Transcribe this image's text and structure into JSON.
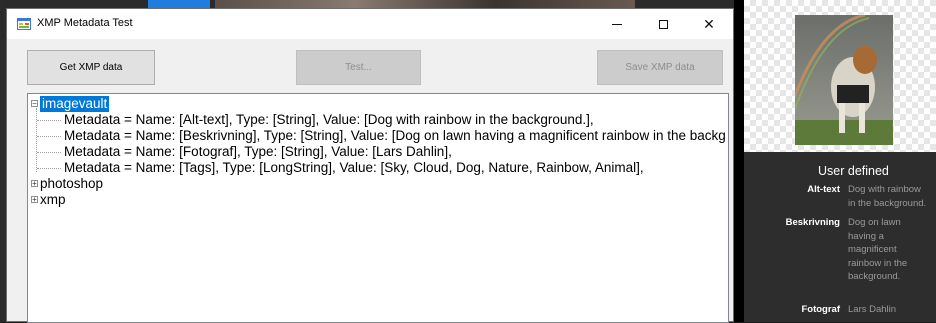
{
  "window": {
    "title": "XMP Metadata Test",
    "controls": {
      "minimize": "–",
      "maximize": "□",
      "close": "✕"
    }
  },
  "toolbar": {
    "get_label": "Get XMP data",
    "test_label": "Test...",
    "save_label": "Save XMP data"
  },
  "tree": {
    "root": {
      "label": "imagevault",
      "expanded": true,
      "children": [
        "Metadata = Name: [Alt-text], Type: [String], Value: [Dog with rainbow in the background.],",
        "Metadata = Name: [Beskrivning], Type: [String], Value: [Dog on lawn having a magnificent rainbow in the backg",
        "Metadata = Name: [Fotograf], Type: [String], Value: [Lars Dahlin],",
        "Metadata = Name: [Tags], Type: [LongString], Value: [Sky, Cloud, Dog, Nature, Rainbow, Animal],"
      ]
    },
    "collapsed_nodes": [
      "photoshop",
      "xmp"
    ]
  },
  "right_panel": {
    "section_title": "User defined",
    "fields": [
      {
        "key": "Alt-text",
        "lines": [
          "Dog with rainbow",
          "in the background."
        ]
      },
      {
        "key": "Beskrivning",
        "lines": [
          "Dog on lawn",
          "having a",
          "magnificent",
          "rainbow in the",
          "background."
        ]
      },
      {
        "key": "Fotograf",
        "lines": [
          "Lars Dahlin"
        ]
      }
    ]
  },
  "colors": {
    "selection": "#0078d7",
    "panel_bg": "#2d2d2d",
    "window_bg": "#f0f0f0"
  }
}
